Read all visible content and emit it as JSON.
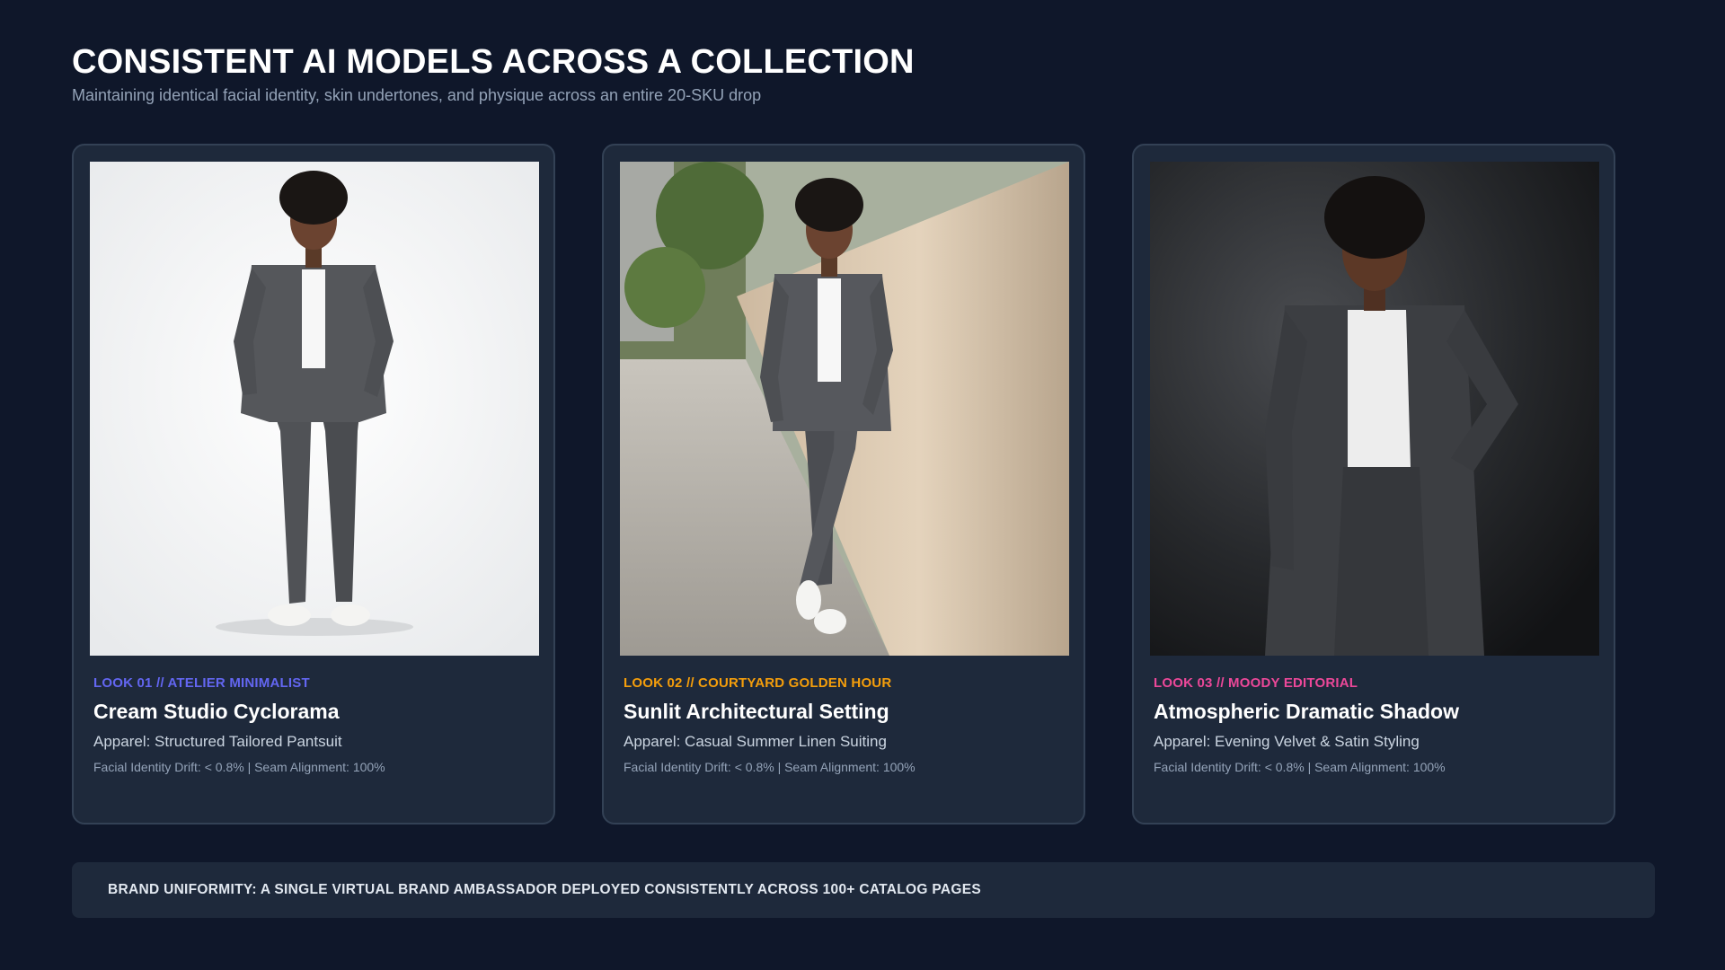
{
  "header": {
    "title": "CONSISTENT AI MODELS ACROSS A COLLECTION",
    "subtitle": "Maintaining identical facial identity, skin undertones, and physique across an entire 20-SKU drop"
  },
  "cards": [
    {
      "label": "LOOK 01 // ATELIER MINIMALIST",
      "label_color": "#6366f1",
      "title": "Cream Studio Cyclorama",
      "apparel": "Apparel: Structured Tailored Pantsuit",
      "metrics": "Facial Identity Drift: < 0.8% | Seam Alignment: 100%",
      "photo": "model-photo-studio"
    },
    {
      "label": "LOOK 02 // COURTYARD GOLDEN HOUR",
      "label_color": "#f59e0b",
      "title": "Sunlit Architectural Setting",
      "apparel": "Apparel: Casual Summer Linen Suiting",
      "metrics": "Facial Identity Drift: < 0.8% | Seam Alignment: 100%",
      "photo": "model-photo-street"
    },
    {
      "label": "LOOK 03 // MOODY EDITORIAL",
      "label_color": "#ec4899",
      "title": "Atmospheric Dramatic Shadow",
      "apparel": "Apparel: Evening Velvet & Satin Styling",
      "metrics": "Facial Identity Drift: < 0.8% | Seam Alignment: 100%",
      "photo": "model-photo-dramatic"
    }
  ],
  "banner": {
    "text": "BRAND UNIFORMITY: A SINGLE VIRTUAL BRAND AMBASSADOR DEPLOYED CONSISTENTLY ACROSS 100+ CATALOG PAGES"
  },
  "colors": {
    "background": "#0f172a",
    "card": "#1e293b",
    "card_border": "#334155"
  }
}
